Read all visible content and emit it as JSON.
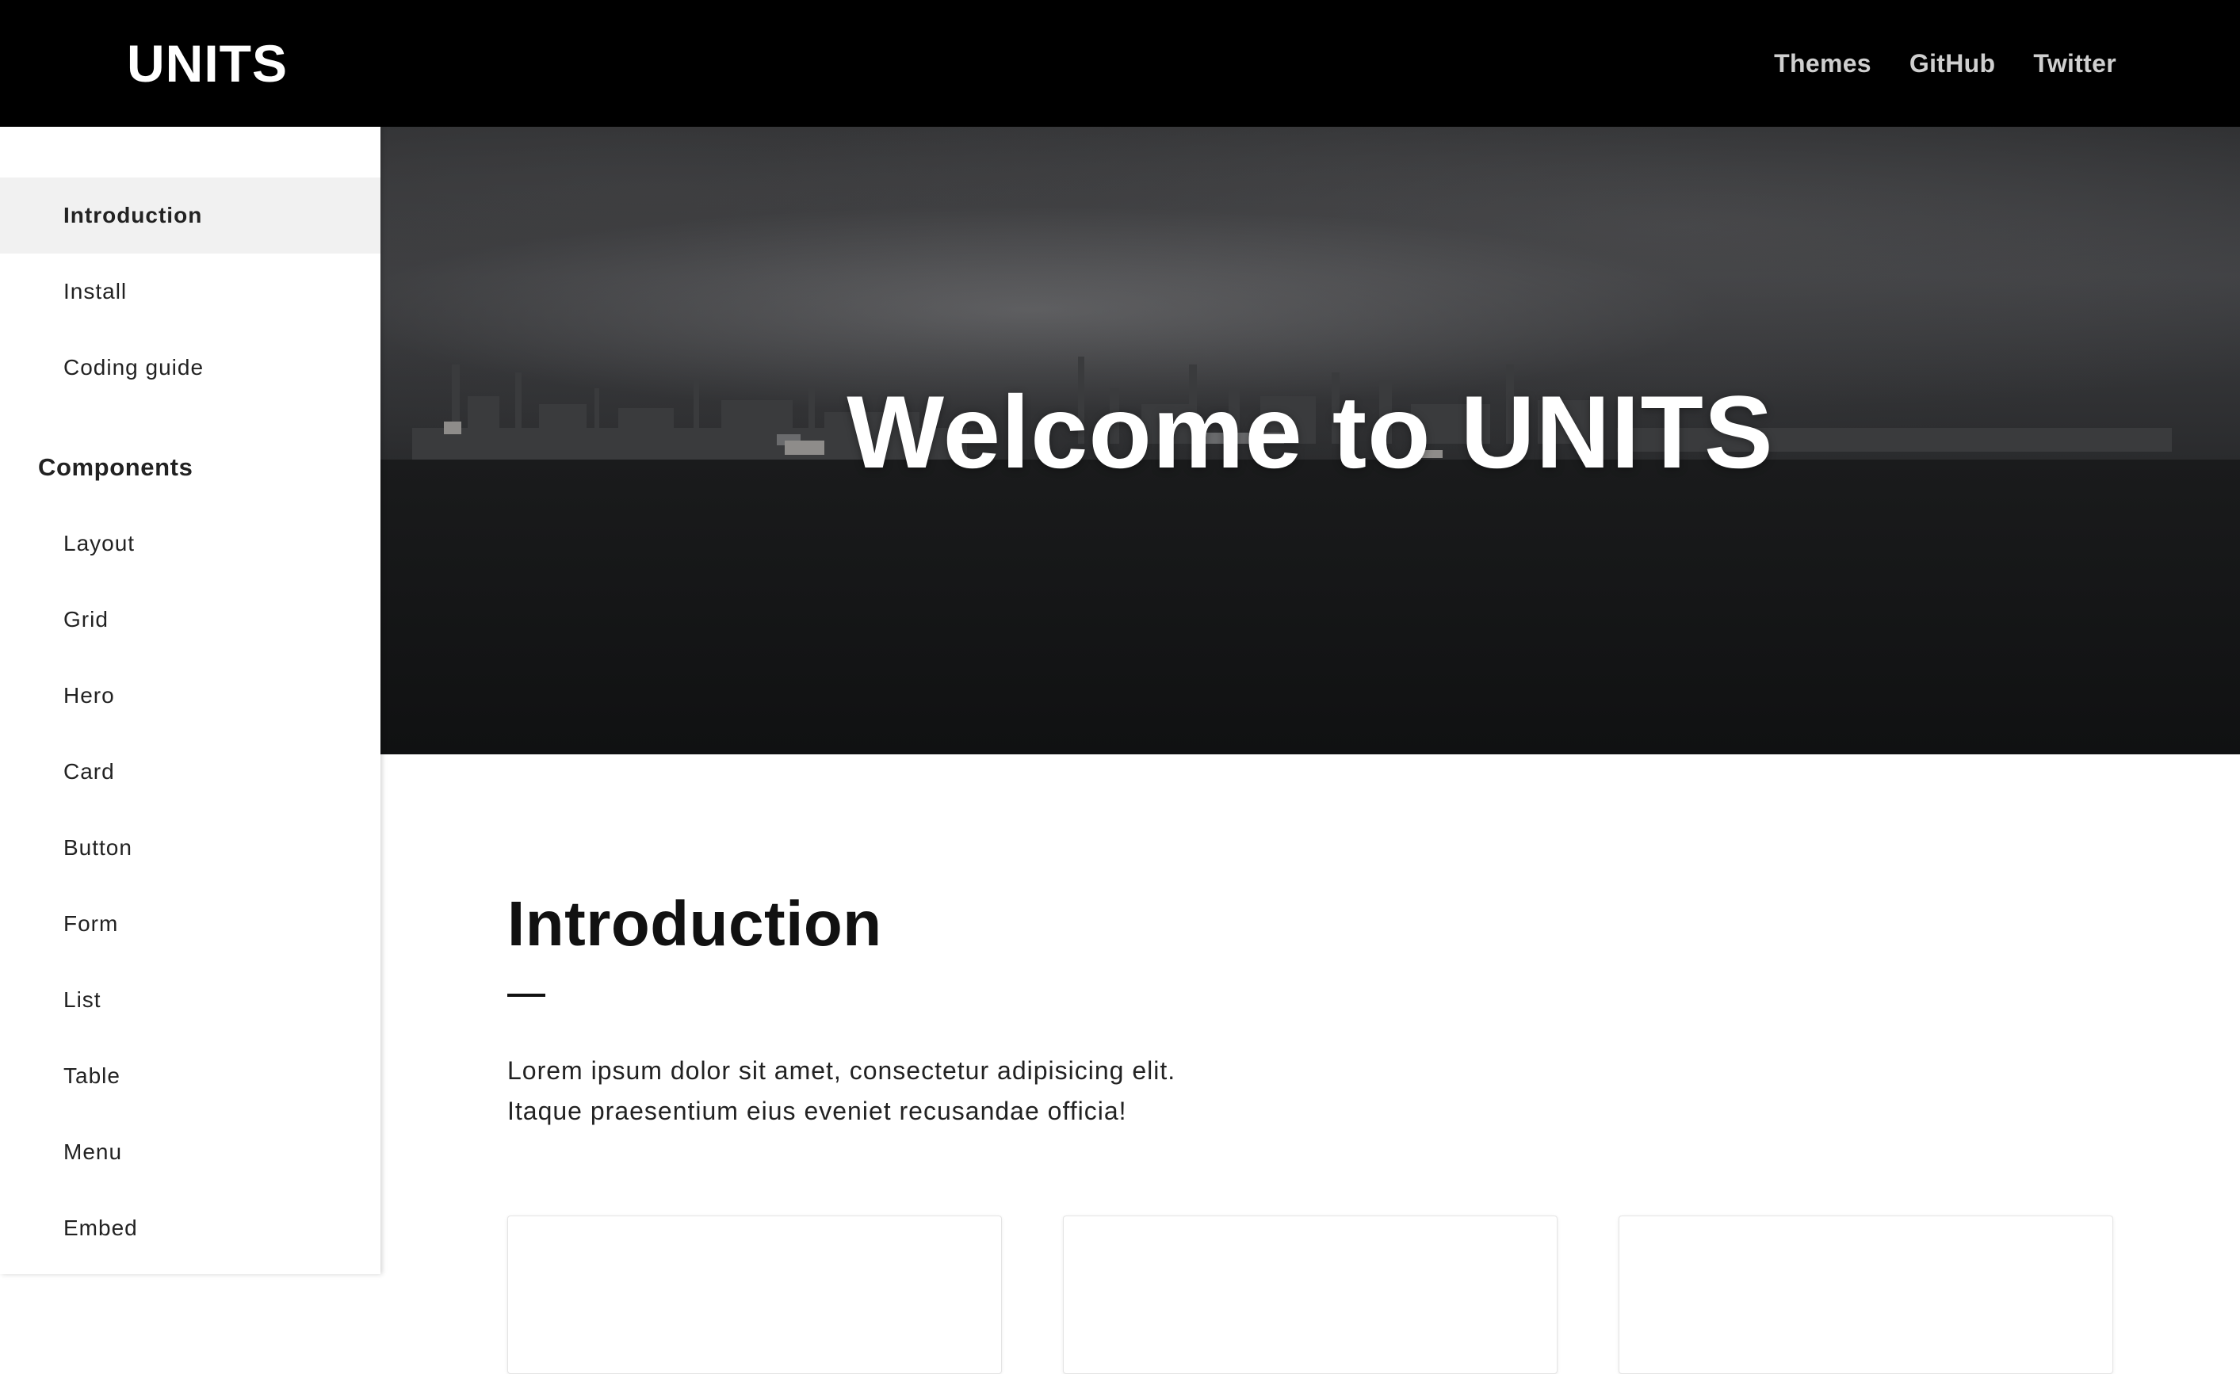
{
  "header": {
    "brand": "UNITS",
    "nav": [
      {
        "label": "Themes"
      },
      {
        "label": "GitHub"
      },
      {
        "label": "Twitter"
      }
    ]
  },
  "sidebar": {
    "items": [
      {
        "label": "Introduction",
        "active": true
      },
      {
        "label": "Install"
      },
      {
        "label": "Coding guide"
      }
    ],
    "components_heading": "Components",
    "components": [
      {
        "label": "Layout"
      },
      {
        "label": "Grid"
      },
      {
        "label": "Hero"
      },
      {
        "label": "Card"
      },
      {
        "label": "Button"
      },
      {
        "label": "Form"
      },
      {
        "label": "List"
      },
      {
        "label": "Table"
      },
      {
        "label": "Menu"
      },
      {
        "label": "Embed"
      }
    ]
  },
  "hero": {
    "title": "Welcome to UNITS"
  },
  "main": {
    "section_title": "Introduction",
    "paragraph_line1": "Lorem ipsum dolor sit amet, consectetur adipisicing elit.",
    "paragraph_line2": "Itaque praesentium eius eveniet recusandae officia!"
  },
  "colors": {
    "topbar": "#000000",
    "active_item_bg": "#f1f1f1",
    "text": "#111111"
  }
}
